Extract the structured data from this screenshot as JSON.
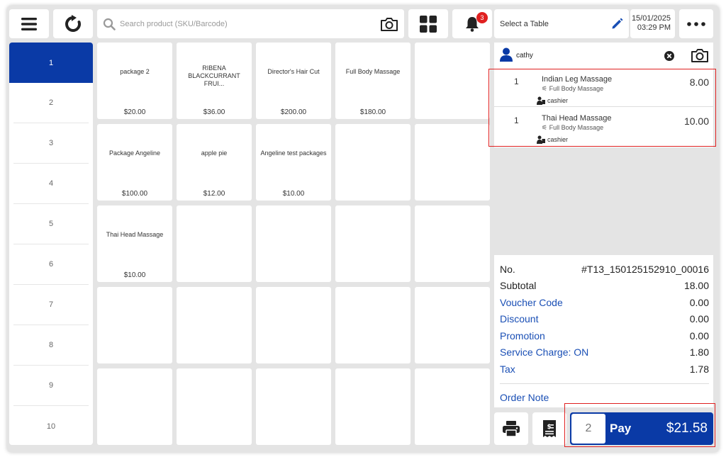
{
  "search": {
    "placeholder": "Search product (SKU/Barcode)"
  },
  "notifications": {
    "count": "3"
  },
  "table": {
    "label": "Select a Table"
  },
  "datetime": {
    "date": "15/01/2025",
    "time": "03:29 PM"
  },
  "categories": [
    "1",
    "2",
    "3",
    "4",
    "5",
    "6",
    "7",
    "8",
    "9",
    "10"
  ],
  "products": [
    {
      "name": "package 2",
      "price": "$20.00"
    },
    {
      "name": "RIBENA BLACKCURRANT FRUI...",
      "price": "$36.00"
    },
    {
      "name": "Director's Hair Cut",
      "price": "$200.00"
    },
    {
      "name": "Full Body Massage",
      "price": "$180.00"
    },
    {
      "name": "Package Angeline",
      "price": "$100.00"
    },
    {
      "name": "apple pie",
      "price": "$12.00"
    },
    {
      "name": "Angeline test packages",
      "price": "$10.00"
    },
    {
      "name": "Thai Head Massage",
      "price": "$10.00"
    }
  ],
  "customer": {
    "name": "cathy"
  },
  "order_items": [
    {
      "qty": "1",
      "name": "Indian Leg Massage",
      "variant": "Full Body Massage",
      "staff": "cashier",
      "price": "8.00"
    },
    {
      "qty": "1",
      "name": "Thai Head Massage",
      "variant": "Full Body Massage",
      "staff": "cashier",
      "price": "10.00"
    }
  ],
  "summary": {
    "no_label": "No.",
    "no_value": "#T13_150125152910_00016",
    "subtotal_label": "Subtotal",
    "subtotal": "18.00",
    "voucher_label": "Voucher Code",
    "voucher": "0.00",
    "discount_label": "Discount",
    "discount": "0.00",
    "promotion_label": "Promotion",
    "promotion": "0.00",
    "service_label": "Service Charge: ON",
    "service": "1.80",
    "tax_label": "Tax",
    "tax": "1.78",
    "note_label": "Order Note"
  },
  "pay": {
    "count": "2",
    "label": "Pay",
    "total": "$21.58"
  },
  "colors": {
    "accent": "#0a3aa6",
    "link": "#1a4fb5",
    "badge": "#e02020",
    "highlight": "#e02020"
  }
}
